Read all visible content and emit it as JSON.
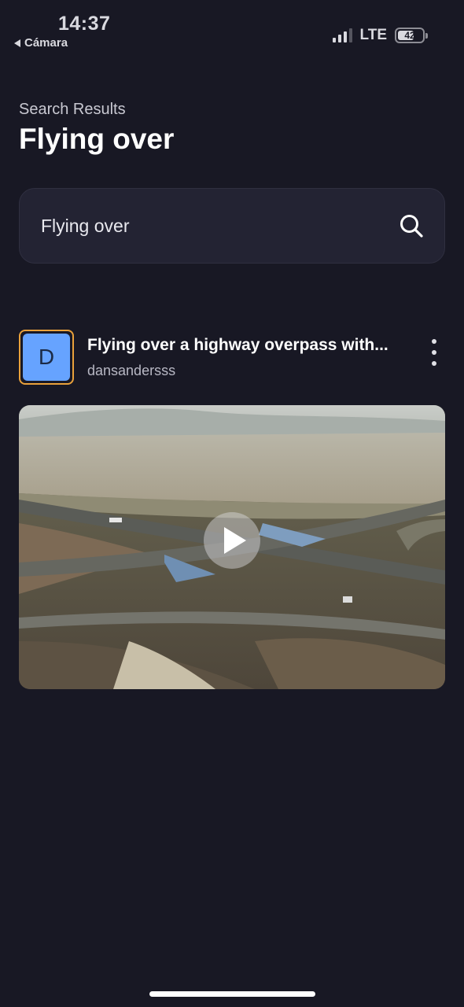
{
  "status_bar": {
    "time": "14:37",
    "back_app": "Cámara",
    "network": "LTE",
    "battery_level": "42"
  },
  "header": {
    "subtitle": "Search Results",
    "title": "Flying over"
  },
  "search": {
    "value": "Flying over",
    "icon": "search-icon"
  },
  "results": [
    {
      "avatar_letter": "D",
      "title": "Flying over a highway overpass with...",
      "author": "dansandersss",
      "has_video": true
    }
  ],
  "colors": {
    "background": "#181824",
    "card": "#232333",
    "avatar_bg": "#66a3ff",
    "avatar_border": "#e9a13b"
  }
}
